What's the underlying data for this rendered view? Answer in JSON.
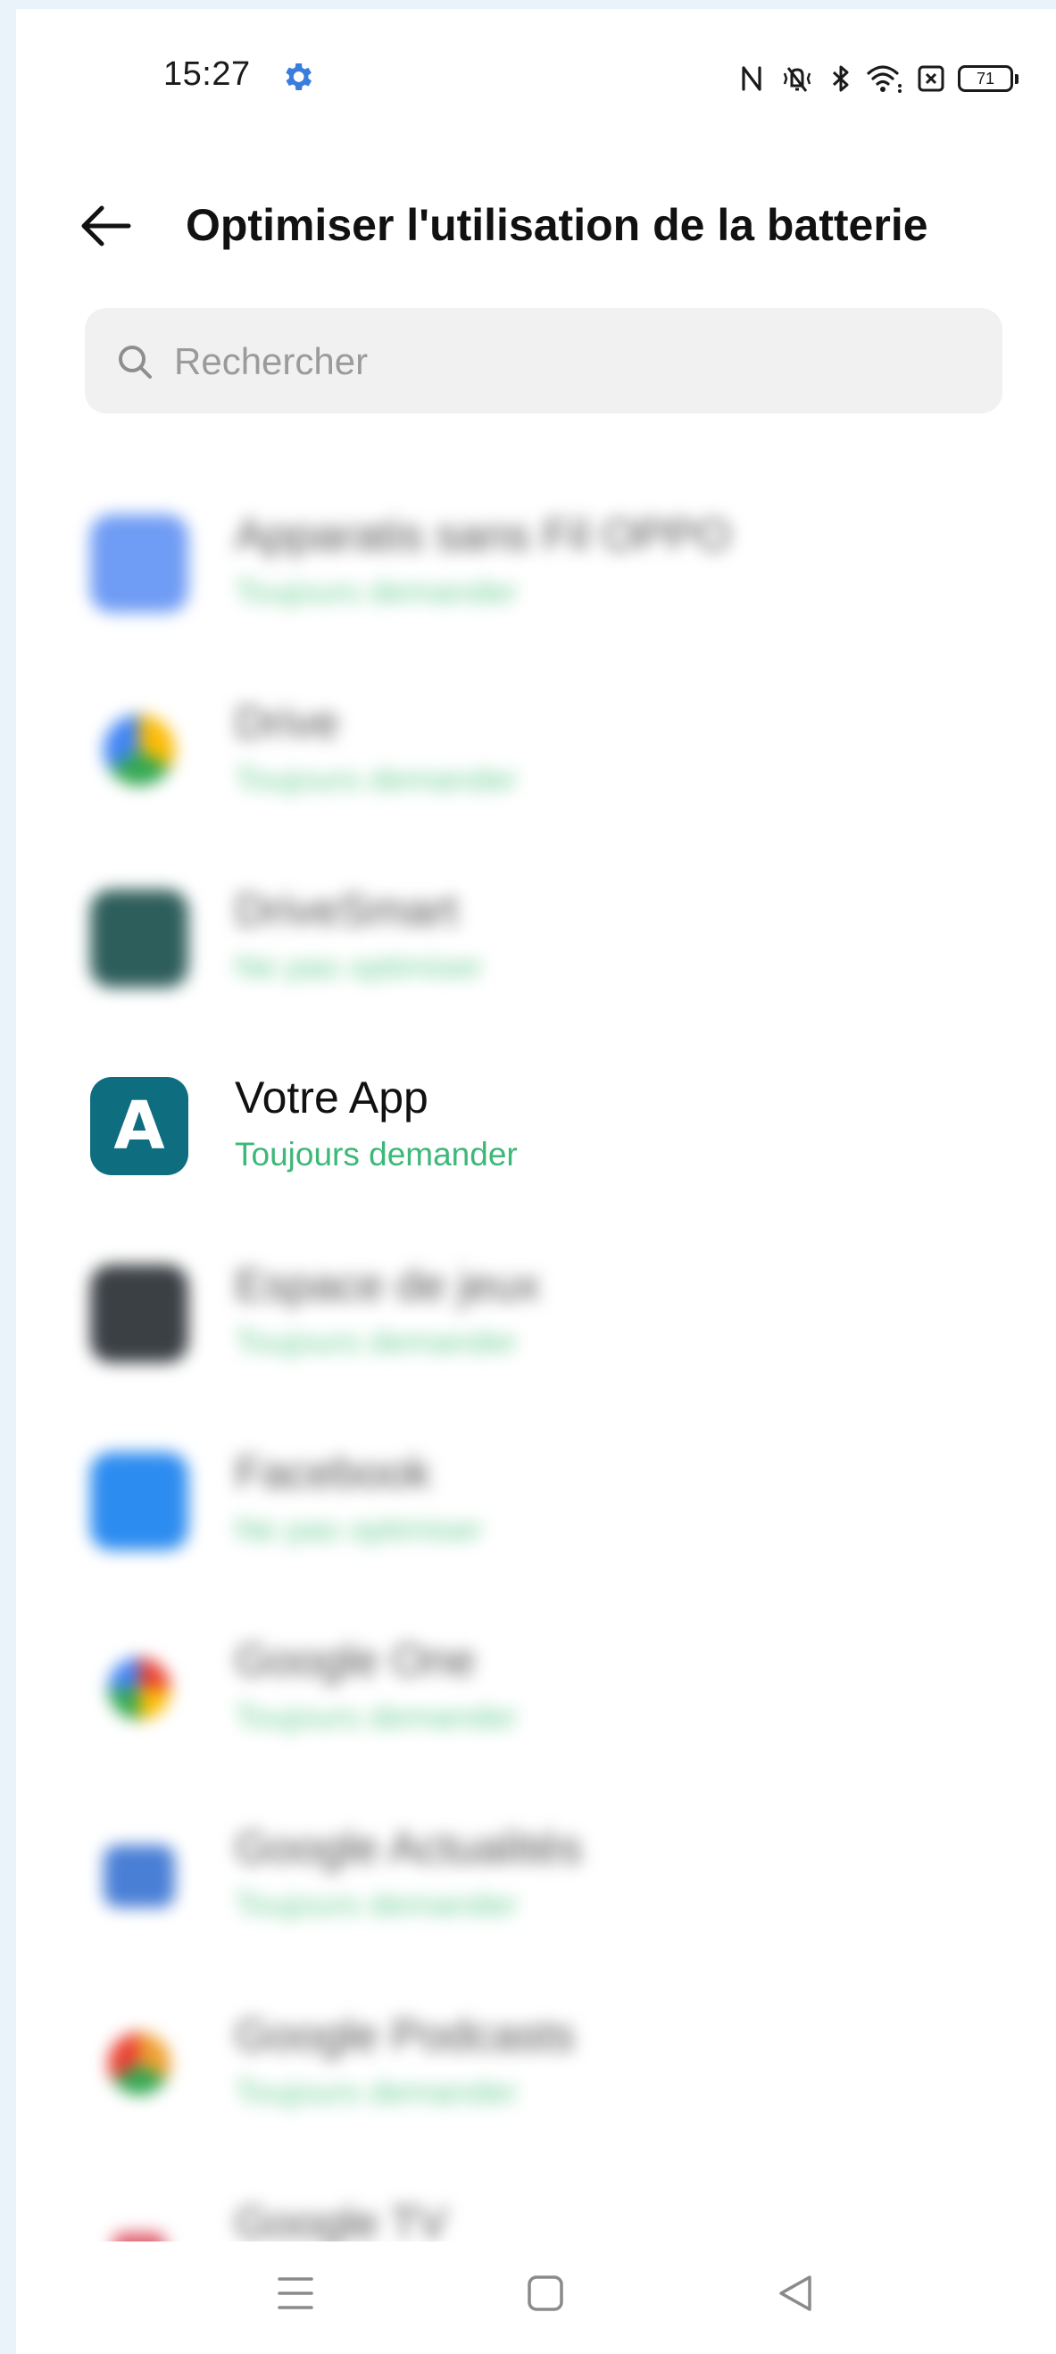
{
  "status_bar": {
    "time": "15:27",
    "battery": "71"
  },
  "header": {
    "title": "Optimiser l'utilisation de la batterie"
  },
  "search": {
    "placeholder": "Rechercher"
  },
  "apps": [
    {
      "name": "Apparatis sans Fil OPPO",
      "status": "Toujours demander",
      "icon_color": "#6f9cf4",
      "blurred": true
    },
    {
      "name": "Drive",
      "status": "Toujours demander",
      "icon_color": "#4caf50",
      "blurred": true
    },
    {
      "name": "DriveSmart",
      "status": "Ne pas optimiser",
      "icon_color": "#2e5e5b",
      "blurred": true
    },
    {
      "name": "Votre App",
      "status": "Toujours demander",
      "icon_color": "#0e6e7f",
      "icon_letter": "A",
      "blurred": false
    },
    {
      "name": "Espace de jeux",
      "status": "Toujours demander",
      "icon_color": "#3b4045",
      "blurred": true
    },
    {
      "name": "Facebook",
      "status": "Ne pas optimiser",
      "icon_color": "#2d8cf0",
      "blurred": true
    },
    {
      "name": "Google One",
      "status": "Toujours demander",
      "icon_color": "#4285f4",
      "blurred": true
    },
    {
      "name": "Google Actualités",
      "status": "Toujours demander",
      "icon_color": "#4a7fd6",
      "blurred": true
    },
    {
      "name": "Google Podcasts",
      "status": "Toujours demander",
      "icon_color": "#f0a030",
      "blurred": true
    },
    {
      "name": "Google TV",
      "status": "",
      "icon_color": "#e06070",
      "blurred": true
    }
  ],
  "colors": {
    "accent_green": "#3cb878",
    "status_gear_blue": "#3b7ddd"
  }
}
